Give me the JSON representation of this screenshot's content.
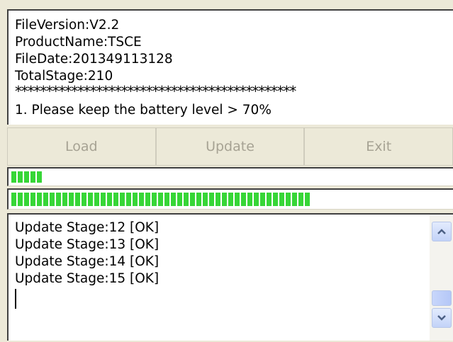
{
  "info": {
    "lines": [
      "FileVersion:V2.2",
      "ProductName:TSCE",
      "FileDate:201349113128",
      "TotalStage:210"
    ],
    "separator": "*********************************************",
    "partial_line": "1. Please keep the battery level > 70%"
  },
  "buttons": {
    "load": "Load",
    "update": "Update",
    "exit": "Exit"
  },
  "progress": {
    "stage": 0.07,
    "overall": 0.68
  },
  "log": {
    "lines": [
      "Update Stage:12 [OK]",
      "Update Stage:13 [OK]",
      "Update Stage:14 [OK]",
      "Update Stage:15 [OK]"
    ]
  },
  "scrollbar": {
    "up_icon": "chevron-up-icon",
    "down_icon": "chevron-down-icon"
  },
  "colors": {
    "progress_fill": "#37d637",
    "disabled_text": "#a6a293",
    "window_bg": "#ece9d8"
  }
}
